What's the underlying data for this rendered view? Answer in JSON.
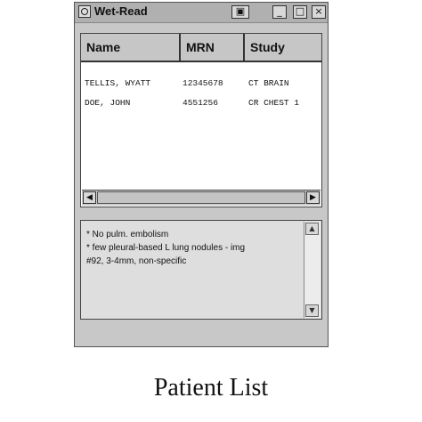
{
  "window": {
    "title": "Wet-Read",
    "buttons": [
      "▣",
      "_",
      "□",
      "×"
    ]
  },
  "table": {
    "columns": [
      "Name",
      "MRN",
      "Study"
    ],
    "rows": [
      {
        "name": "TELLIS, WYATT",
        "mrn": "12345678",
        "study": "CT BRAIN"
      },
      {
        "name": "DOE, JOHN",
        "mrn": "4551256",
        "study": "CR CHEST 1"
      }
    ]
  },
  "notes": {
    "lines": [
      "* No pulm. embolism",
      "* few pleural-based L lung nodules - img",
      "#92, 3-4mm, non-specific"
    ]
  },
  "scroll_arrows": {
    "left": "◀",
    "right": "▶",
    "up": "▲",
    "down": "▼"
  },
  "caption": "Patient List"
}
